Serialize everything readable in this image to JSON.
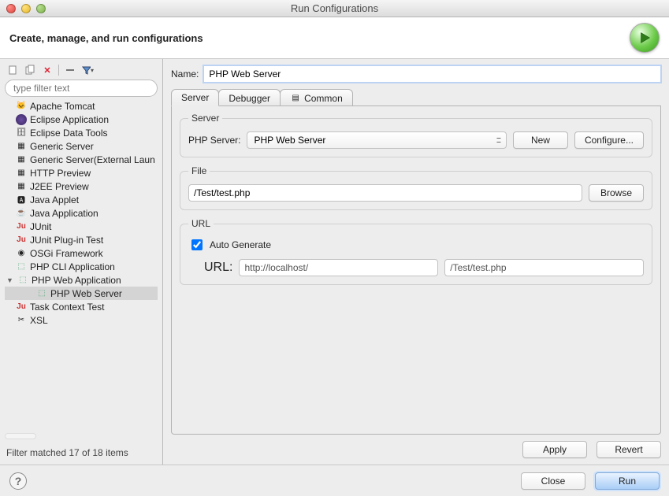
{
  "title": "Run Configurations",
  "header": {
    "text": "Create, manage, and run configurations"
  },
  "sidebar": {
    "filter_placeholder": "type filter text",
    "items": [
      {
        "label": "Apache Tomcat",
        "icon": "tomcat-icon"
      },
      {
        "label": "Eclipse Application",
        "icon": "eclipse-icon"
      },
      {
        "label": "Eclipse Data Tools",
        "icon": "database-icon"
      },
      {
        "label": "Generic Server",
        "icon": "server-icon"
      },
      {
        "label": "Generic Server(External Laun",
        "icon": "server-icon"
      },
      {
        "label": "HTTP Preview",
        "icon": "server-icon"
      },
      {
        "label": "J2EE Preview",
        "icon": "server-icon"
      },
      {
        "label": "Java Applet",
        "icon": "applet-icon"
      },
      {
        "label": "Java Application",
        "icon": "java-icon"
      },
      {
        "label": "JUnit",
        "icon": "junit-icon"
      },
      {
        "label": "JUnit Plug-in Test",
        "icon": "junit-icon"
      },
      {
        "label": "OSGi Framework",
        "icon": "osgi-icon"
      },
      {
        "label": "PHP CLI Application",
        "icon": "php-icon"
      },
      {
        "label": "PHP Web Application",
        "icon": "php-icon",
        "expanded": true
      },
      {
        "label": "Task Context Test",
        "icon": "junit-icon"
      },
      {
        "label": "XSL",
        "icon": "xsl-icon"
      }
    ],
    "child": {
      "label": "PHP Web Server",
      "icon": "php-icon"
    },
    "filter_match": "Filter matched 17 of 18 items"
  },
  "name": {
    "label": "Name:",
    "value": "PHP Web Server"
  },
  "tabs": {
    "server": "Server",
    "debugger": "Debugger",
    "common": "Common"
  },
  "server": {
    "legend": "Server",
    "label": "PHP Server:",
    "value": "PHP Web Server",
    "new": "New",
    "configure": "Configure..."
  },
  "file": {
    "legend": "File",
    "value": "/Test/test.php",
    "browse": "Browse"
  },
  "url": {
    "legend": "URL",
    "auto": "Auto Generate",
    "label": "URL:",
    "host": "http://localhost/",
    "path": "/Test/test.php"
  },
  "actions": {
    "apply": "Apply",
    "revert": "Revert"
  },
  "footer": {
    "close": "Close",
    "run": "Run"
  }
}
